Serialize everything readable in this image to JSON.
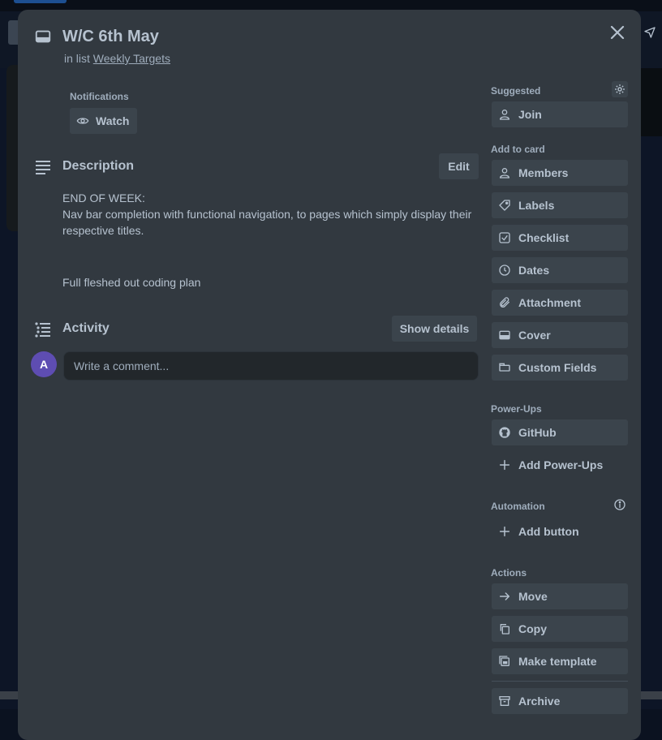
{
  "card": {
    "title": "W/C 6th May",
    "list_prefix": "in list",
    "list_name": "Weekly Targets"
  },
  "notifications": {
    "label": "Notifications",
    "watch_label": "Watch"
  },
  "description": {
    "heading": "Description",
    "edit_label": "Edit",
    "line1": "END OF WEEK:",
    "line2": "Nav bar completion with functional navigation, to pages which simply display their respective titles.",
    "line3": "Full fleshed out coding plan"
  },
  "activity": {
    "heading": "Activity",
    "show_details_label": "Show details",
    "avatar_initial": "A",
    "comment_placeholder": "Write a comment..."
  },
  "sidebar": {
    "suggested": {
      "label": "Suggested",
      "join": "Join"
    },
    "add_to_card": {
      "label": "Add to card",
      "members": "Members",
      "labels": "Labels",
      "checklist": "Checklist",
      "dates": "Dates",
      "attachment": "Attachment",
      "cover": "Cover",
      "custom_fields": "Custom Fields"
    },
    "power_ups": {
      "label": "Power-Ups",
      "github": "GitHub",
      "add_power_ups": "Add Power-Ups"
    },
    "automation": {
      "label": "Automation",
      "add_button": "Add button"
    },
    "actions": {
      "label": "Actions",
      "move": "Move",
      "copy": "Copy",
      "make_template": "Make template",
      "archive": "Archive"
    }
  },
  "colors": {
    "modal_bg": "#323940",
    "button_bg": "#3b444c",
    "text": "#b6c2cf",
    "avatar_bg": "#5e4db2"
  }
}
